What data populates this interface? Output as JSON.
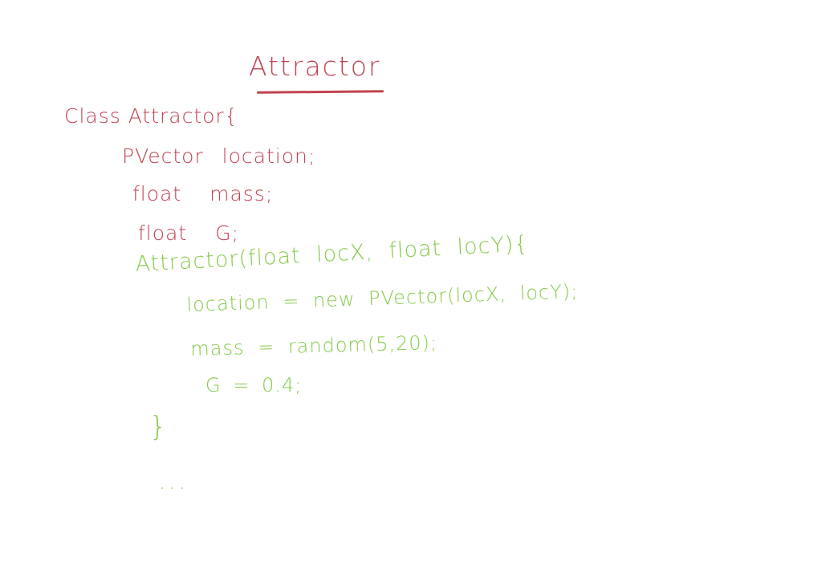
{
  "title": "Attractor",
  "colors": {
    "red_ink": "#c2424f",
    "green_ink": "#84cb4a",
    "background": "#ffffff"
  },
  "code_lines": {
    "class_decl": "Class Attractor{",
    "field_location": "PVector location;",
    "field_mass": "float mass;",
    "field_g": "float G;",
    "constructor_decl": "Attractor(float locX, float locY){",
    "assign_location": "location = new PVector(locX, locY);",
    "assign_mass": "mass = random(5,20);",
    "assign_g": "G = 0.4;",
    "close_brace": "}",
    "ellipsis": "..."
  }
}
